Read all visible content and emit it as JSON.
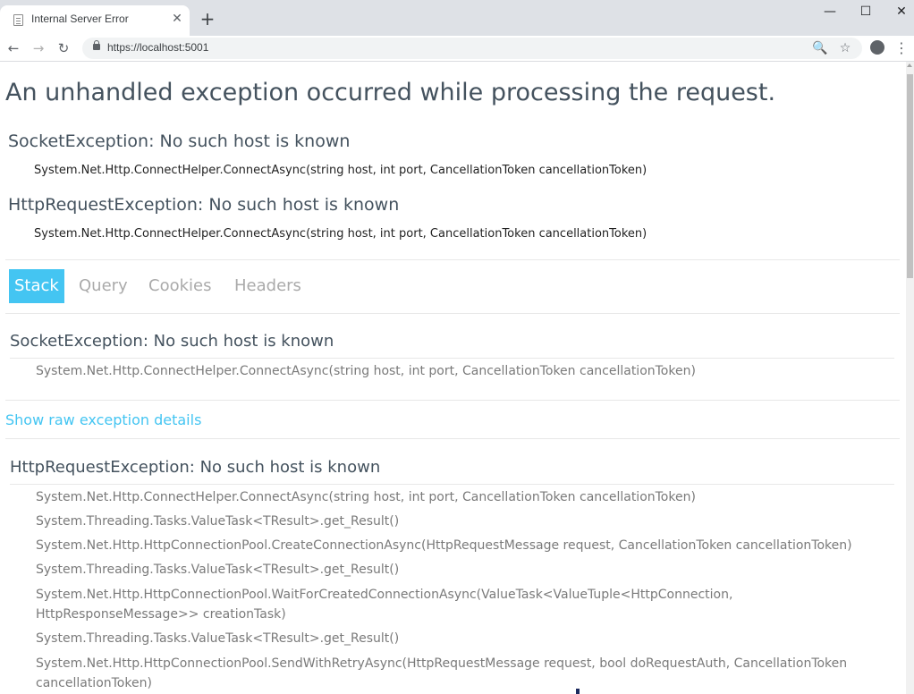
{
  "browser": {
    "tab_title": "Internal Server Error",
    "tab_close": "✕",
    "new_tab": "+",
    "url": "https://localhost:5001",
    "window_controls": {
      "minimize": "—",
      "maximize": "☐",
      "close": "✕"
    },
    "nav": {
      "back": "←",
      "forward": "→",
      "reload": "↻"
    },
    "omni_icons": {
      "zoom": "🔍",
      "bookmark": "☆"
    },
    "menu": "⋮"
  },
  "page": {
    "title": "An unhandled exception occurred while processing the request.",
    "summary": [
      {
        "type": "SocketException: No such host is known",
        "location": "System.Net.Http.ConnectHelper.ConnectAsync(string host, int port, CancellationToken cancellationToken)"
      },
      {
        "type": "HttpRequestException: No such host is known",
        "location": "System.Net.Http.ConnectHelper.ConnectAsync(string host, int port, CancellationToken cancellationToken)"
      }
    ],
    "tabs": [
      "Stack",
      "Query",
      "Cookies",
      "Headers"
    ],
    "active_tab": "Stack",
    "stack": [
      {
        "title": "SocketException: No such host is known",
        "frames": [
          "System.Net.Http.ConnectHelper.ConnectAsync(string host, int port, CancellationToken cancellationToken)"
        ],
        "raw_link": "Show raw exception details"
      },
      {
        "title": "HttpRequestException: No such host is known",
        "frames": [
          "System.Net.Http.ConnectHelper.ConnectAsync(string host, int port, CancellationToken cancellationToken)",
          "System.Threading.Tasks.ValueTask<TResult>.get_Result()",
          "System.Net.Http.HttpConnectionPool.CreateConnectionAsync(HttpRequestMessage request, CancellationToken cancellationToken)",
          "System.Threading.Tasks.ValueTask<TResult>.get_Result()",
          "System.Net.Http.HttpConnectionPool.WaitForCreatedConnectionAsync(ValueTask<ValueTuple<HttpConnection, HttpResponseMessage>> creationTask)",
          "System.Threading.Tasks.ValueTask<TResult>.get_Result()",
          "System.Net.Http.HttpConnectionPool.SendWithRetryAsync(HttpRequestMessage request, bool doRequestAuth, CancellationToken cancellationToken)"
        ]
      }
    ]
  },
  "colors": {
    "accent": "#44c5f2",
    "heading": "#44525e",
    "frame_text": "#7a7a7a"
  }
}
